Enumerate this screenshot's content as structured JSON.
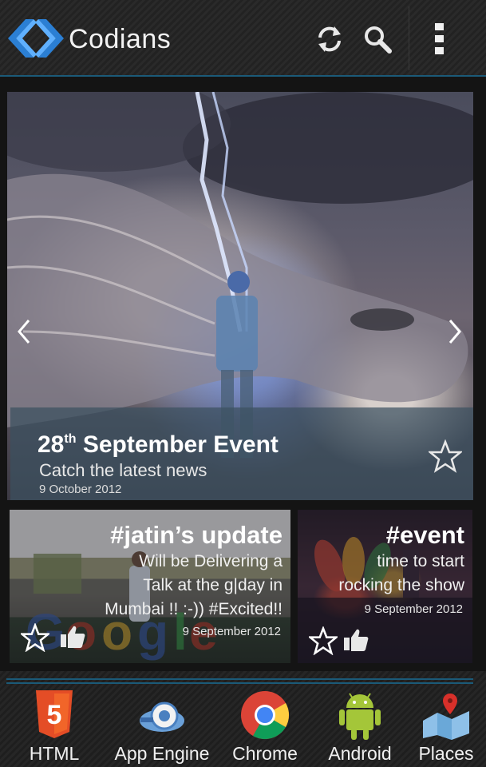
{
  "app": {
    "title": "Codians"
  },
  "actionbar": {
    "refresh_icon": "refresh-icon",
    "search_icon": "search-icon",
    "overflow_icon": "overflow-menu-icon",
    "accent": "#1b5a78"
  },
  "hero": {
    "title_day": "28",
    "title_suffix": "th",
    "title_rest": " September Event",
    "subtitle": "Catch the latest news",
    "date": "9 October 2012"
  },
  "cards": [
    {
      "title": "#jatin’s update",
      "body_lines": [
        "Will be Delivering a",
        "Talk at the g|day in",
        "Mumbai !! :-)) #Excited!!"
      ],
      "date": "9 September 2012"
    },
    {
      "title": "#event",
      "body_lines": [
        "time to start",
        "rocking the show"
      ],
      "date": "9 September 2012"
    }
  ],
  "categories": [
    {
      "label": "HTML",
      "icon": "html5-icon"
    },
    {
      "label": "App Engine",
      "icon": "app-engine-icon"
    },
    {
      "label": "Chrome",
      "icon": "chrome-icon"
    },
    {
      "label": "Android",
      "icon": "android-icon"
    },
    {
      "label": "Places",
      "icon": "places-icon"
    }
  ]
}
